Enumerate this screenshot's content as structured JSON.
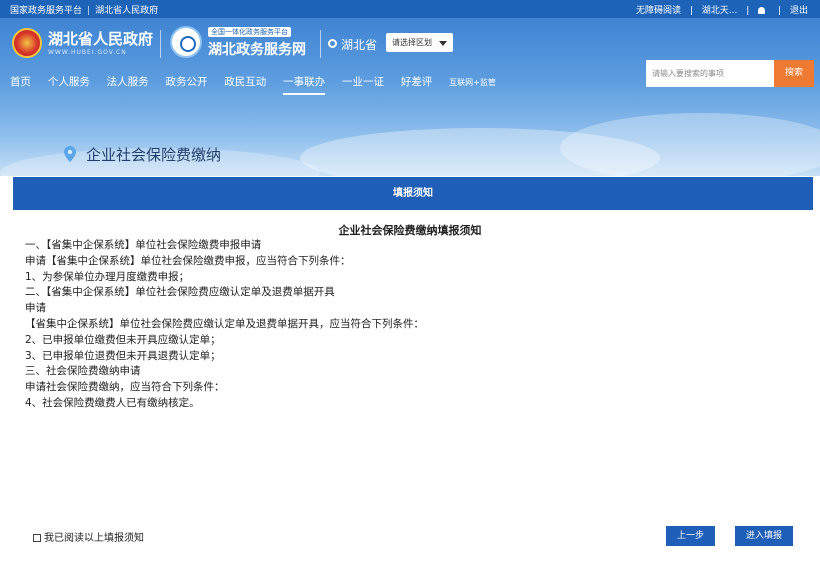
{
  "topbar": {
    "national_platform": "国家政务服务平台",
    "provincial_gov": "湖北省人民政府",
    "accessibility": "无障碍阅读",
    "user": "湖北天...",
    "logout": "退出"
  },
  "header": {
    "gov_title": "湖北省人民政府",
    "gov_domain": "WWW.HUBEI.GOV.CN",
    "service_tag": "全国一体化政务服务平台",
    "service_title": "湖北政务服务网",
    "location": "湖北省",
    "region_select": "请选择区划"
  },
  "nav": {
    "items": [
      {
        "label": "首页"
      },
      {
        "label": "个人服务"
      },
      {
        "label": "法人服务"
      },
      {
        "label": "政务公开"
      },
      {
        "label": "政民互动"
      },
      {
        "label": "一事联办"
      },
      {
        "label": "一业一证"
      },
      {
        "label": "好差评"
      },
      {
        "label": "互联网+监管"
      }
    ],
    "active_index": 5
  },
  "search": {
    "placeholder": "请输入要搜索的事项",
    "button": "搜索"
  },
  "page": {
    "title": "企业社会保险费缴纳"
  },
  "section": {
    "header": "填报须知"
  },
  "doc": {
    "title": "企业社会保险费缴纳填报须知",
    "lines": [
      "一、【省集中企保系统】单位社会保险缴费申报申请",
      "申请【省集中企保系统】单位社会保险缴费申报，应当符合下列条件：",
      "1、为参保单位办理月度缴费申报；",
      "二、【省集中企保系统】单位社会保险费应缴认定单及退费单据开具",
      "申请",
      "【省集中企保系统】单位社会保险费应缴认定单及退费单据开具，应当符合下列条件：",
      "2、已申报单位缴费但未开具应缴认定单；",
      "3、已申报单位退费但未开具退费认定单；",
      "三、社会保险费缴纳申请",
      "申请社会保险费缴纳，应当符合下列条件：",
      "4、社会保险费缴费人已有缴纳核定。"
    ]
  },
  "footer": {
    "agree_label": "我已阅读以上填报须知",
    "prev_button": "上一步",
    "next_button": "进入填报"
  },
  "colors": {
    "brand_blue": "#1f5fb7",
    "search_orange": "#ef7a32"
  }
}
